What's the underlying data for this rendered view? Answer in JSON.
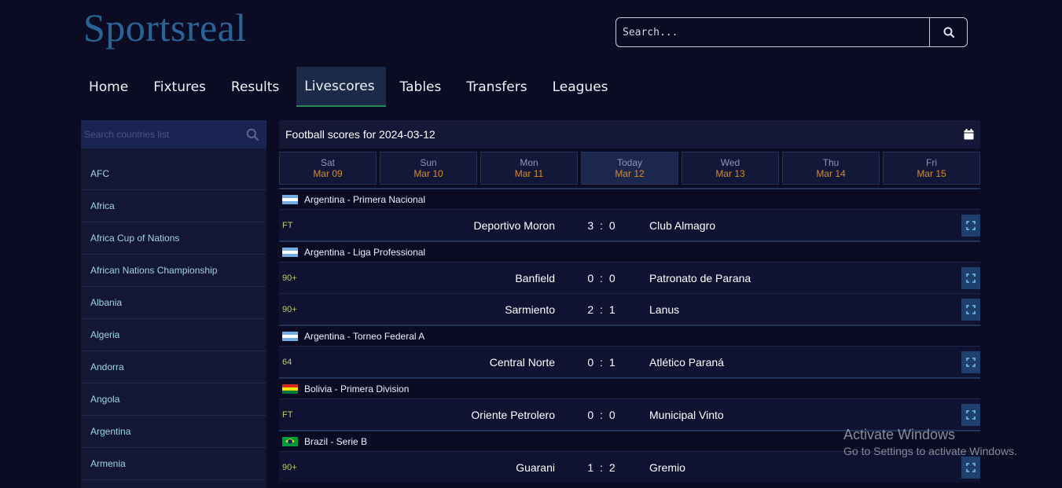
{
  "site": {
    "logo": "Sportsreal"
  },
  "search": {
    "placeholder": "Search..."
  },
  "nav": {
    "items": [
      {
        "label": "Home"
      },
      {
        "label": "Fixtures"
      },
      {
        "label": "Results"
      },
      {
        "label": "Livescores",
        "active": true
      },
      {
        "label": "Tables"
      },
      {
        "label": "Transfers"
      },
      {
        "label": "Leagues"
      }
    ]
  },
  "sidebar": {
    "search_placeholder": "Search countries list",
    "countries": [
      "AFC",
      "Africa",
      "Africa Cup of Nations",
      "African Nations Championship",
      "Albania",
      "Algeria",
      "Andorra",
      "Angola",
      "Argentina",
      "Armenia"
    ]
  },
  "main": {
    "header_title": "Football scores for 2024-03-12",
    "dates": [
      {
        "day": "Sat",
        "date": "Mar 09"
      },
      {
        "day": "Sun",
        "date": "Mar 10"
      },
      {
        "day": "Mon",
        "date": "Mar 11"
      },
      {
        "day": "Today",
        "date": "Mar 12",
        "active": true
      },
      {
        "day": "Wed",
        "date": "Mar 13"
      },
      {
        "day": "Thu",
        "date": "Mar 14"
      },
      {
        "day": "Fri",
        "date": "Mar 15"
      }
    ],
    "leagues": [
      {
        "flag": "ar",
        "name": "Argentina - Primera Nacional",
        "matches": [
          {
            "status": "FT",
            "home": "Deportivo Moron",
            "score": "3 : 0",
            "away": "Club Almagro"
          }
        ]
      },
      {
        "flag": "ar",
        "name": "Argentina - Liga Professional",
        "matches": [
          {
            "status": "90+",
            "home": "Banfield",
            "score": "0 : 0",
            "away": "Patronato de Parana"
          },
          {
            "status": "90+",
            "home": "Sarmiento",
            "score": "2 : 1",
            "away": "Lanus"
          }
        ]
      },
      {
        "flag": "ar",
        "name": "Argentina - Torneo Federal A",
        "matches": [
          {
            "status": "64",
            "home": "Central Norte",
            "score": "0 : 1",
            "away": "Atlético Paraná"
          }
        ]
      },
      {
        "flag": "bo",
        "name": "Bolivia - Primera Division",
        "matches": [
          {
            "status": "FT",
            "home": "Oriente Petrolero",
            "score": "0 : 0",
            "away": "Municipal Vinto"
          }
        ]
      },
      {
        "flag": "br",
        "name": "Brazil - Serie B",
        "matches": [
          {
            "status": "90+",
            "home": "Guarani",
            "score": "1 : 2",
            "away": "Gremio"
          }
        ]
      }
    ]
  },
  "watermark": {
    "line1": "Activate Windows",
    "line2": "Go to Settings to activate Windows."
  },
  "colors": {
    "background": "#0b0c24",
    "accent_date": "#d68a2a",
    "logo": "#2a6496",
    "active_tab_underline": "#2b8a5a"
  }
}
